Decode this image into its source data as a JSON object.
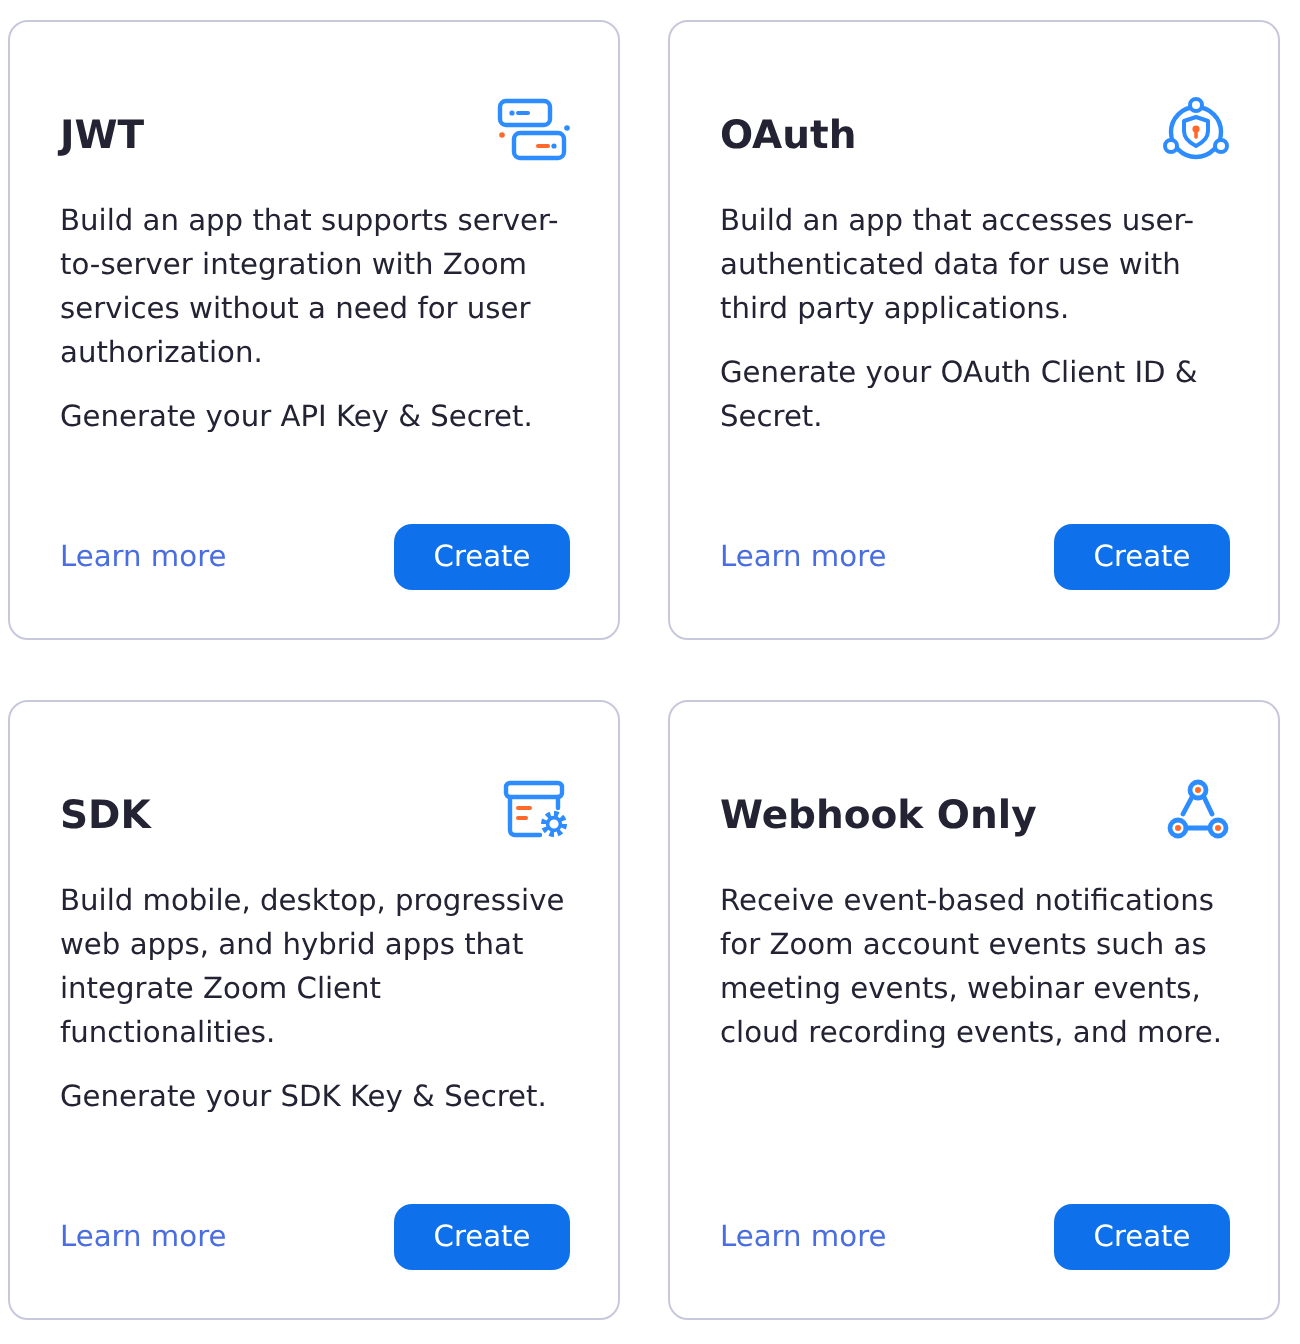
{
  "cards": [
    {
      "kind": "jwt",
      "title": "JWT",
      "description": [
        "Build an app that supports server-to-server integration with Zoom services without a need for user authorization.",
        "Generate your API Key & Secret."
      ],
      "link": "Learn more",
      "button": "Create"
    },
    {
      "kind": "oauth",
      "title": "OAuth",
      "description": [
        "Build an app that accesses user-authenticated data for use with third party applications.",
        "Generate your OAuth Client ID & Secret."
      ],
      "link": "Learn more",
      "button": "Create"
    },
    {
      "kind": "sdk",
      "title": "SDK",
      "description": [
        "Build mobile, desktop, progressive web apps, and hybrid apps that integrate Zoom Client functionalities.",
        "Generate your SDK Key & Secret."
      ],
      "link": "Learn more",
      "button": "Create"
    },
    {
      "kind": "webhook",
      "title": "Webhook Only",
      "description": [
        "Receive event-based notifications for Zoom account events such as meeting events, webinar events, cloud recording events, and more."
      ],
      "link": "Learn more",
      "button": "Create"
    }
  ]
}
